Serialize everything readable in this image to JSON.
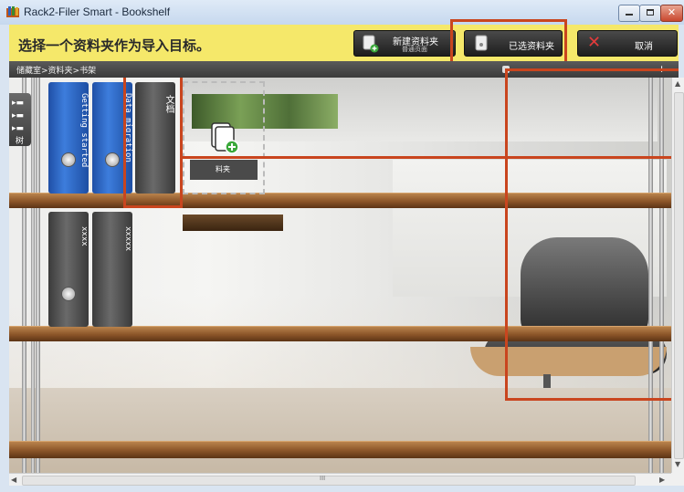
{
  "window": {
    "title": "Rack2-Filer Smart - Bookshelf"
  },
  "toolbar": {
    "prompt": "选择一个资料夹作为导入目标。",
    "new_folder_label": "新建资料夹",
    "new_folder_sublabel": "普通页面",
    "selected_folder_label": "已选资料夹",
    "cancel_label": "取消"
  },
  "breadcrumb": "储藏室>资料夹>书架",
  "zoom_plus": "+",
  "sidebar": {
    "tree_label": "树"
  },
  "shelf": {
    "binders": [
      {
        "label": "Getting started",
        "color": "blue"
      },
      {
        "label": "Data migration",
        "color": "blue"
      },
      {
        "label": "文档",
        "color": "gray",
        "selected": true
      },
      {
        "label": "xxxx",
        "color": "gray"
      },
      {
        "label": "xxxxx",
        "color": "gray"
      }
    ],
    "new_folder_tile_label": "料夹"
  },
  "scrollbar": {
    "h_grip": "III"
  },
  "colors": {
    "accent_yellow": "#f5e86a",
    "highlight": "#c9451e",
    "cancel_red": "#e23b3b",
    "binder_blue": "#2f66c6"
  }
}
